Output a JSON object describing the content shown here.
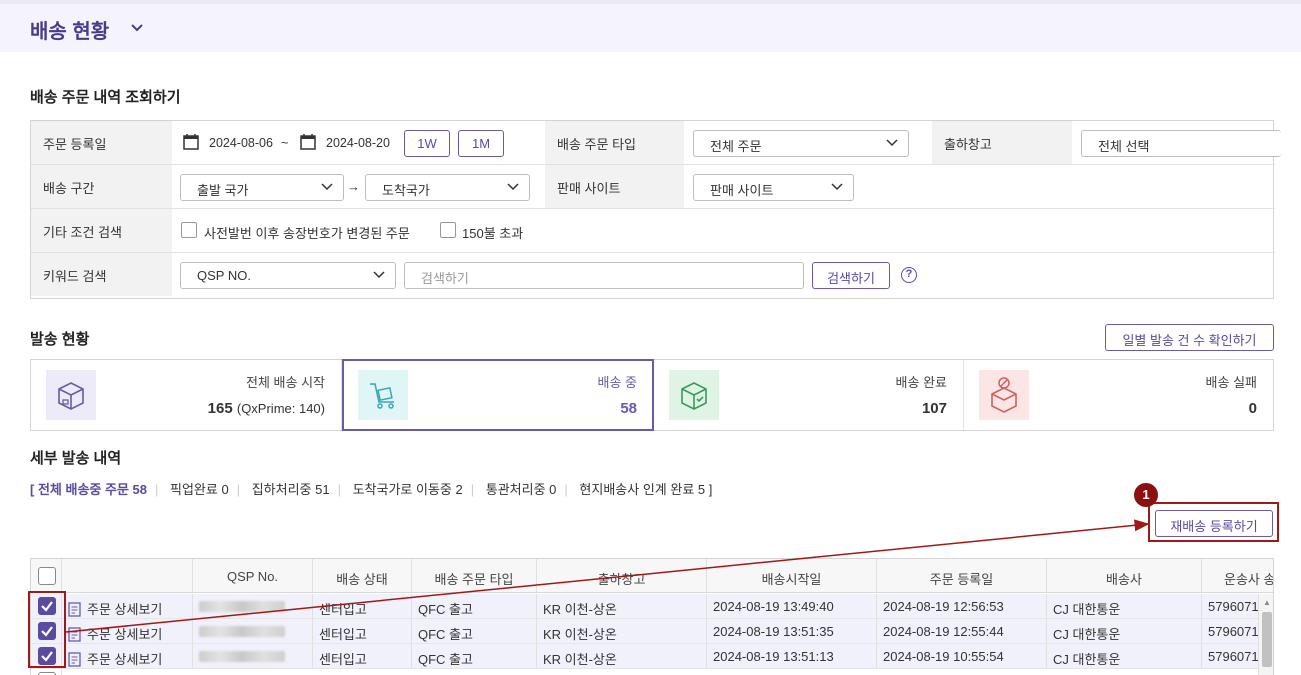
{
  "header": {
    "title": "배송 현황"
  },
  "section_query": {
    "title": "배송 주문 내역 조회하기"
  },
  "filters": {
    "order_date": {
      "label": "주문 등록일",
      "start": "2024-08-06",
      "tilde": "~",
      "end": "2024-08-20",
      "btn_1w": "1W",
      "btn_1m": "1M"
    },
    "order_type": {
      "label": "배송 주문 타입",
      "value": "전체 주문"
    },
    "warehouse": {
      "label": "출하창고",
      "value": "전체 선택"
    },
    "route": {
      "label": "배송 구간",
      "from": "출발 국가",
      "arrow": "→",
      "to": "도착국가"
    },
    "site": {
      "label": "판매 사이트",
      "value": "판매 사이트"
    },
    "etc": {
      "label": "기타 조건 검색",
      "opt1": "사전발번 이후 송장번호가 변경된 주문",
      "opt2": "150불 초과"
    },
    "keyword": {
      "label": "키워드 검색",
      "type": "QSP NO.",
      "placeholder": "검색하기",
      "search_btn": "검색하기",
      "help": "?"
    }
  },
  "section_status": {
    "title": "발송 현황",
    "daily_btn": "일별 발송 건 수 확인하기"
  },
  "stats": [
    {
      "label": "전체 배송 시작",
      "value": "165",
      "sub": "(QxPrime: 140)",
      "icon": "box-icon",
      "color": "#ecebf7"
    },
    {
      "label": "배송 중",
      "value": "58",
      "sub": "",
      "icon": "cart-icon",
      "color": "#dff5f6"
    },
    {
      "label": "배송 완료",
      "value": "107",
      "sub": "",
      "icon": "box-check-icon",
      "color": "#e0f4e6"
    },
    {
      "label": "배송 실패",
      "value": "0",
      "sub": "",
      "icon": "box-fail-icon",
      "color": "#fbe5e5"
    }
  ],
  "section_detail": {
    "title": "세부 발송 내역"
  },
  "breakdown": {
    "open": "[",
    "all": "전체 배송중 주문  58",
    "items": [
      "픽업완료  0",
      "집하처리중  51",
      "도착국가로 이동중  2",
      "통관처리중  0",
      "현지배송사 인계 완료  5"
    ],
    "close": "]"
  },
  "reship_btn": "재배송 등록하기",
  "callout_number": "1",
  "table": {
    "columns": [
      "",
      "",
      "QSP No.",
      "배송 상태",
      "배송 주문 타입",
      "출하창고",
      "배송시작일",
      "주문 등록일",
      "배송사",
      "운송사 송"
    ],
    "detail_label": "주문 상세보기",
    "rows": [
      {
        "status": "센터입고",
        "type": "QFC 출고",
        "warehouse": "KR 이천-상온",
        "ship_start": "2024-08-19 13:49:40",
        "order_date": "2024-08-19 12:56:53",
        "carrier": "CJ 대한통운",
        "tracking": "5796071"
      },
      {
        "status": "센터입고",
        "type": "QFC 출고",
        "warehouse": "KR 이천-상온",
        "ship_start": "2024-08-19 13:51:35",
        "order_date": "2024-08-19 12:55:44",
        "carrier": "CJ 대한통운",
        "tracking": "5796071"
      },
      {
        "status": "센터입고",
        "type": "QFC 출고",
        "warehouse": "KR 이천-상온",
        "ship_start": "2024-08-19 13:51:13",
        "order_date": "2024-08-19 10:55:54",
        "carrier": "CJ 대한통운",
        "tracking": "5796071"
      }
    ]
  },
  "colors": {
    "accent": "#5a4aa0",
    "callout": "#a01818"
  }
}
